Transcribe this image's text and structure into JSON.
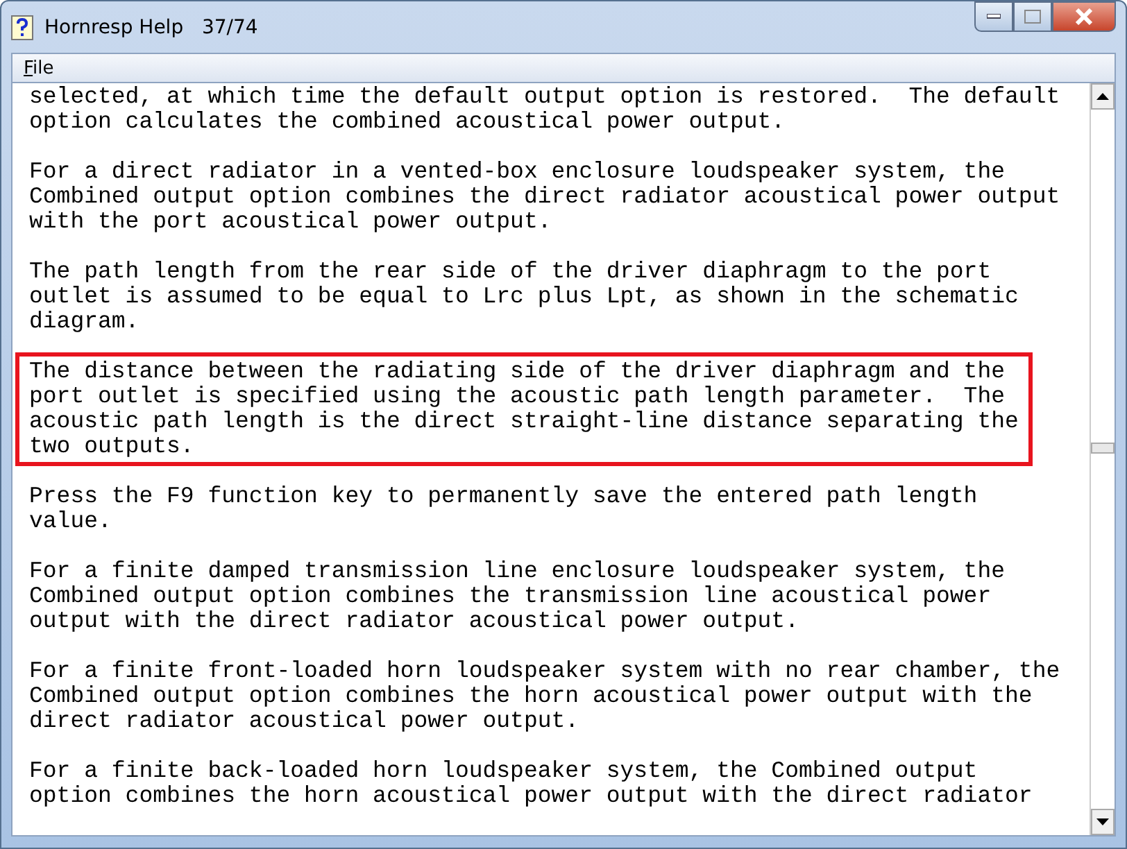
{
  "window": {
    "title": "Hornresp Help",
    "page": "37/74"
  },
  "menu": [
    "File"
  ],
  "paragraphs": [
    {
      "text": "selected, at which time the default output option is restored.  The default\noption calculates the combined acoustical power output.",
      "highlighted": false
    },
    {
      "text": "For a direct radiator in a vented-box enclosure loudspeaker system, the\nCombined output option combines the direct radiator acoustical power output\nwith the port acoustical power output.",
      "highlighted": false
    },
    {
      "text": "The path length from the rear side of the driver diaphragm to the port\noutlet is assumed to be equal to Lrc plus Lpt, as shown in the schematic\ndiagram.",
      "highlighted": false
    },
    {
      "text": "The distance between the radiating side of the driver diaphragm and the\nport outlet is specified using the acoustic path length parameter.  The\nacoustic path length is the direct straight-line distance separating the\ntwo outputs.",
      "highlighted": true
    },
    {
      "text": "Press the F9 function key to permanently save the entered path length\nvalue.",
      "highlighted": false
    },
    {
      "text": "For a finite damped transmission line enclosure loudspeaker system, the\nCombined output option combines the transmission line acoustical power\noutput with the direct radiator acoustical power output.",
      "highlighted": false
    },
    {
      "text": "For a finite front-loaded horn loudspeaker system with no rear chamber, the\nCombined output option combines the horn acoustical power output with the\ndirect radiator acoustical power output.",
      "highlighted": false
    },
    {
      "text": "For a finite back-loaded horn loudspeaker system, the Combined output\noption combines the horn acoustical power output with the direct radiator",
      "highlighted": false
    }
  ]
}
